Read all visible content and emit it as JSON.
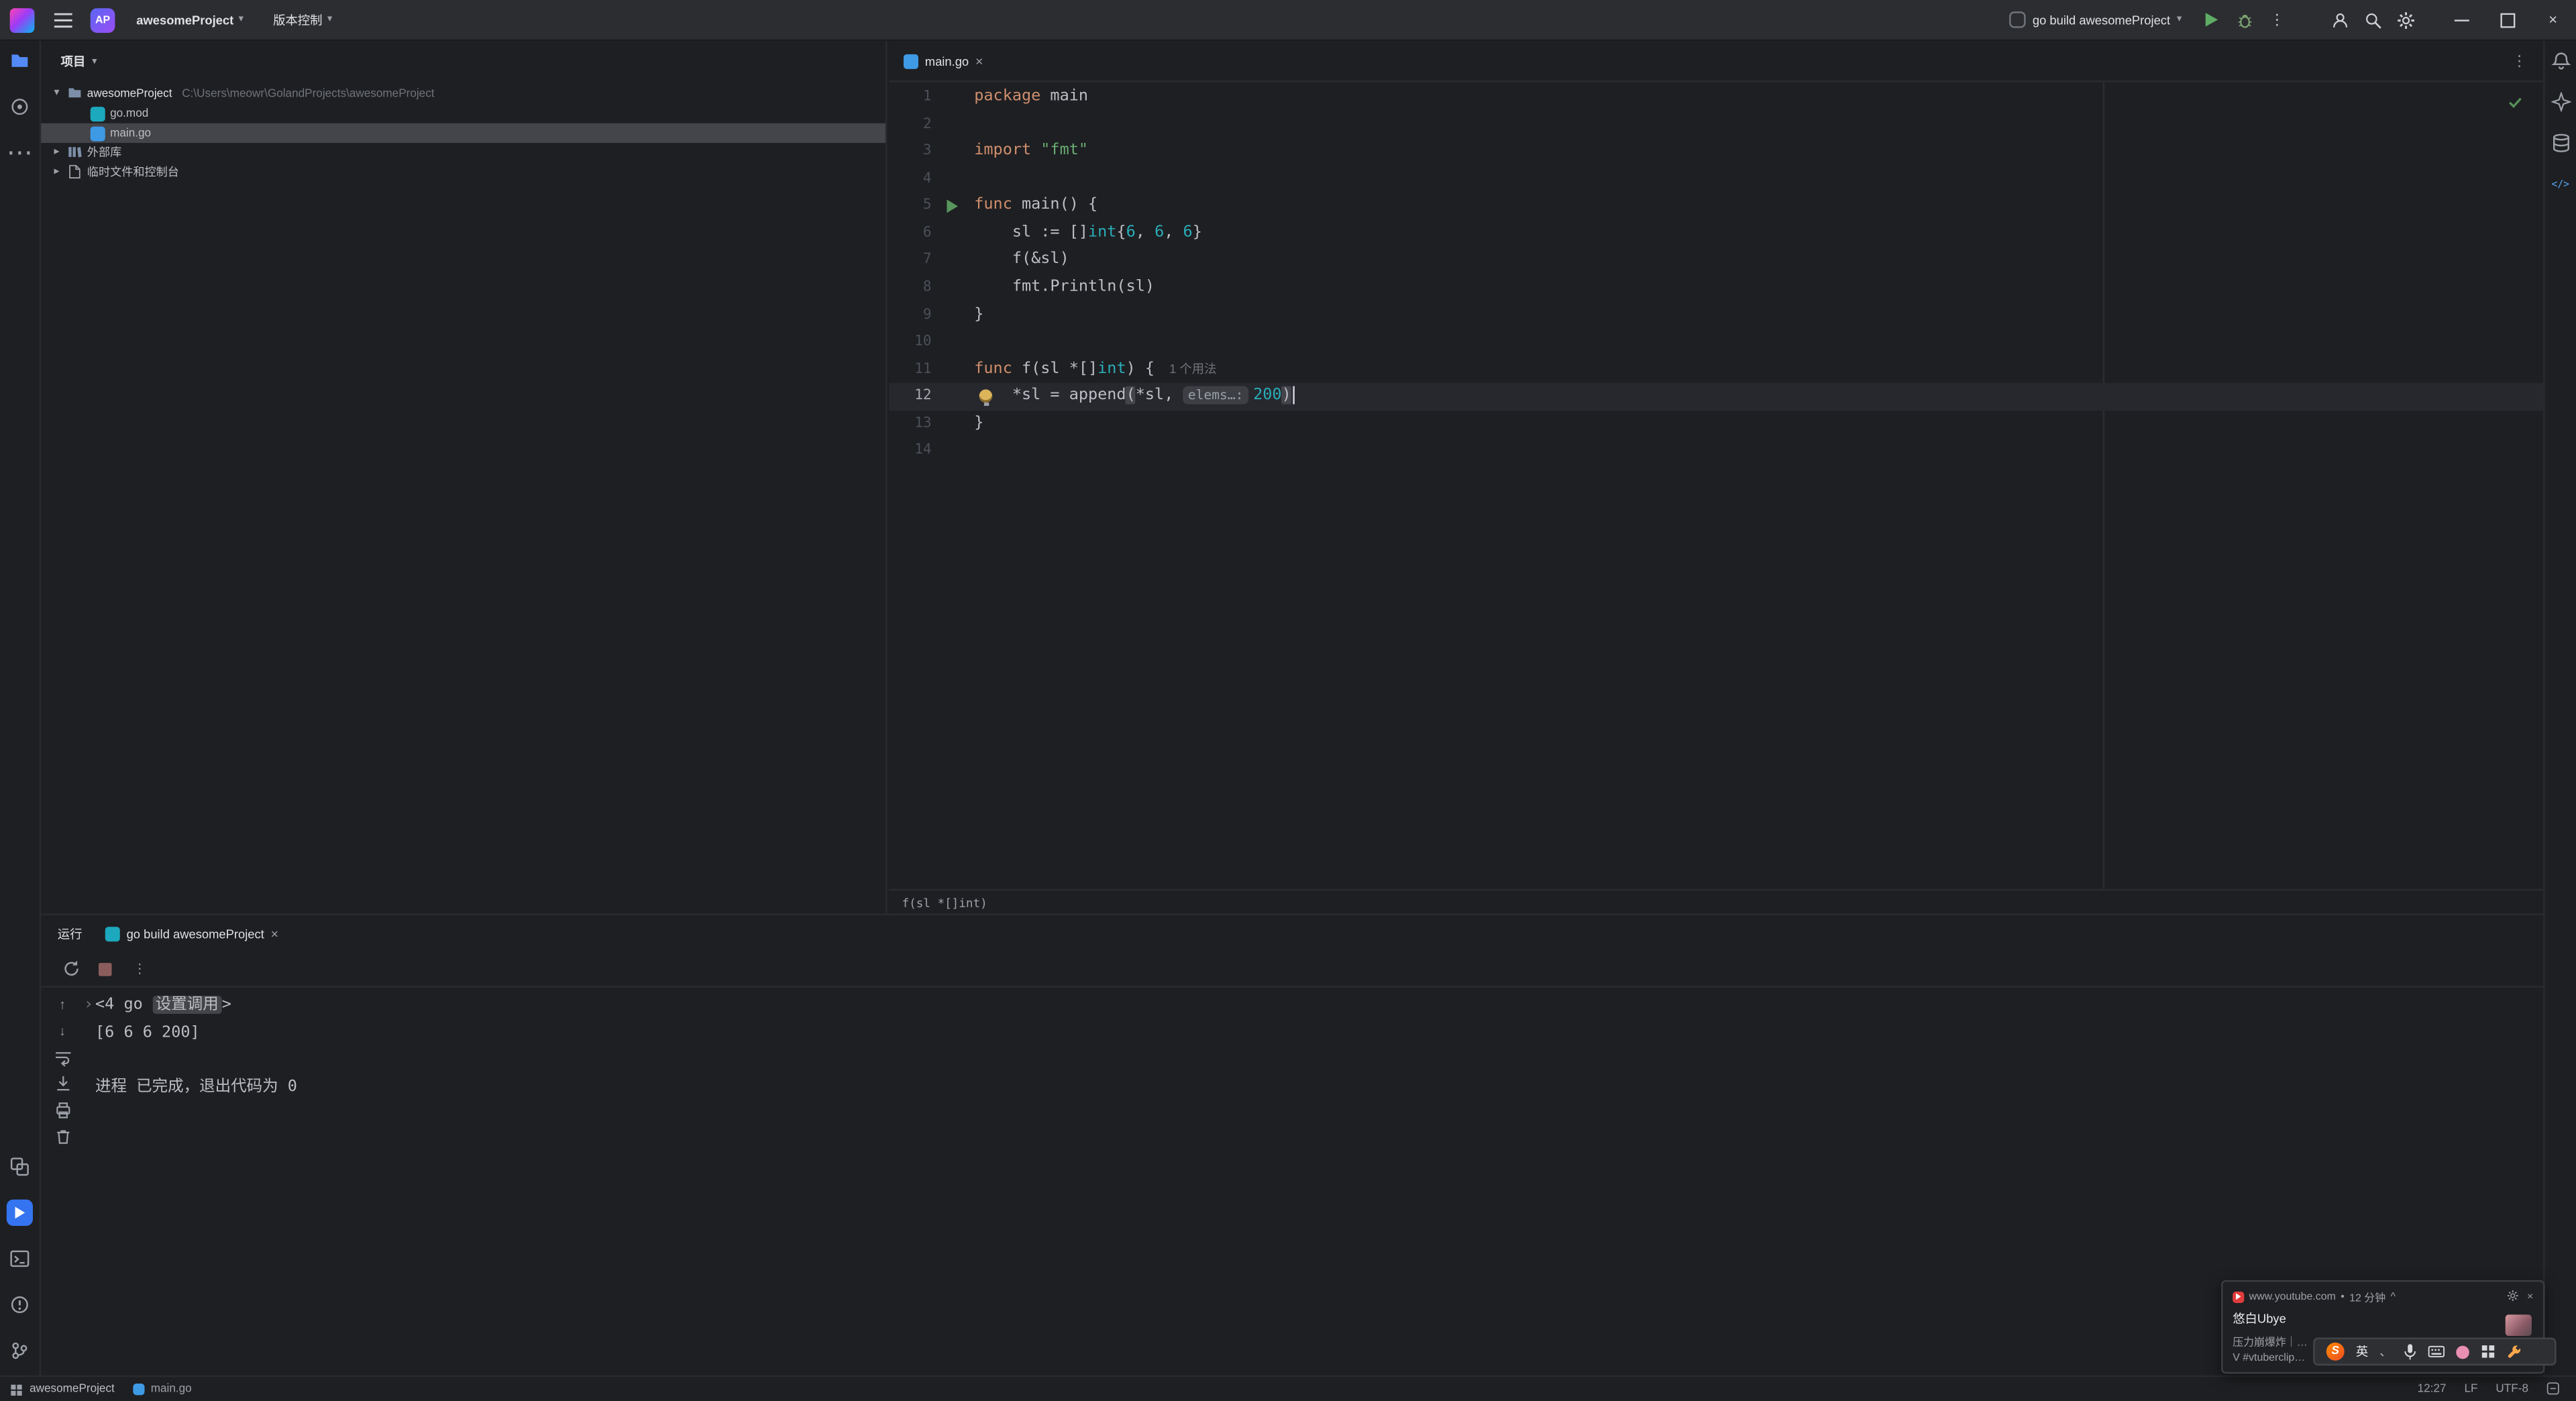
{
  "titlebar": {
    "project_badge": "AP",
    "project_name": "awesomeProject",
    "vcs_label": "版本控制",
    "run_config": "go build awesomeProject"
  },
  "icons": {
    "chevron_down": "▾",
    "chevron_right": "▸",
    "more_vertical": "⋮",
    "more_horizontal": "⋯",
    "close": "×",
    "arrow_up": "↑",
    "arrow_down": "↓",
    "fold_arrow": "›",
    "toast_chevron": "^",
    "bullet": "•",
    "code_tool": "</>"
  },
  "project_panel": {
    "title": "项目",
    "root_name": "awesomeProject",
    "root_path": "C:\\Users\\meowr\\GolandProjects\\awesomeProject",
    "files": [
      {
        "label": "go.mod"
      },
      {
        "label": "main.go"
      }
    ],
    "groups": [
      {
        "label": "外部库"
      },
      {
        "label": "临时文件和控制台"
      }
    ]
  },
  "editor": {
    "tab": "main.go",
    "breadcrumb": "f(sl *[]int)",
    "lines": [
      {
        "n": 1,
        "seg": [
          {
            "t": "package",
            "c": "kw"
          },
          {
            "t": " main",
            "c": "d"
          }
        ]
      },
      {
        "n": 2,
        "seg": []
      },
      {
        "n": 3,
        "seg": [
          {
            "t": "import",
            "c": "kw"
          },
          {
            "t": " ",
            "c": "d"
          },
          {
            "t": "\"fmt\"",
            "c": "str"
          }
        ]
      },
      {
        "n": 4,
        "seg": []
      },
      {
        "n": 5,
        "run": true,
        "seg": [
          {
            "t": "func",
            "c": "kw"
          },
          {
            "t": " main() {",
            "c": "d"
          }
        ]
      },
      {
        "n": 6,
        "seg": [
          {
            "t": "    sl := []",
            "c": "d"
          },
          {
            "t": "int",
            "c": "ty"
          },
          {
            "t": "{",
            "c": "d"
          },
          {
            "t": "6",
            "c": "num"
          },
          {
            "t": ", ",
            "c": "d"
          },
          {
            "t": "6",
            "c": "num"
          },
          {
            "t": ", ",
            "c": "d"
          },
          {
            "t": "6",
            "c": "num"
          },
          {
            "t": "}",
            "c": "d"
          }
        ]
      },
      {
        "n": 7,
        "seg": [
          {
            "t": "    f(&sl)",
            "c": "d"
          }
        ]
      },
      {
        "n": 8,
        "seg": [
          {
            "t": "    fmt.Println(sl)",
            "c": "d"
          }
        ]
      },
      {
        "n": 9,
        "seg": [
          {
            "t": "}",
            "c": "d"
          }
        ]
      },
      {
        "n": 10,
        "seg": []
      },
      {
        "n": 11,
        "hint": "1 个用法",
        "seg": [
          {
            "t": "func",
            "c": "kw"
          },
          {
            "t": " f(sl *[]",
            "c": "d"
          },
          {
            "t": "int",
            "c": "ty"
          },
          {
            "t": ") {",
            "c": "d"
          }
        ]
      },
      {
        "n": 12,
        "cur": true,
        "bulb": true,
        "caret": true,
        "seg": [
          {
            "t": "    *sl = append",
            "c": "d"
          },
          {
            "t": "(",
            "c": "br"
          },
          {
            "t": "*sl, ",
            "c": "d"
          },
          {
            "t": "elems…:",
            "c": "inlay"
          },
          {
            "t": "200",
            "c": "num"
          },
          {
            "t": ")",
            "c": "br"
          }
        ]
      },
      {
        "n": 13,
        "seg": [
          {
            "t": "}",
            "c": "d"
          }
        ]
      },
      {
        "n": 14,
        "seg": []
      }
    ]
  },
  "run_panel": {
    "title": "运行",
    "tab": "go build awesomeProject",
    "console": {
      "lines": [
        {
          "fold": true,
          "seg": [
            {
              "t": "<4 go ",
              "c": "d"
            },
            {
              "t": "设置调用",
              "c": "chip"
            },
            {
              "t": ">",
              "c": "d"
            }
          ]
        },
        {
          "seg": [
            {
              "t": "[6 6 6 200]",
              "c": "d"
            }
          ]
        },
        {
          "seg": []
        },
        {
          "seg": [
            {
              "t": "进程 已完成，退出代码为 0",
              "c": "d"
            }
          ]
        }
      ]
    }
  },
  "statusbar": {
    "project": "awesomeProject",
    "file": "main.go",
    "position": "12:27",
    "line_separator": "LF",
    "encoding": "UTF-8"
  },
  "toast": {
    "source": "www.youtube.com",
    "time": "12 分钟",
    "title": "悠白Ubye",
    "line1": "压力崩爆炸｜…",
    "line2": "V #vtuberclip…"
  },
  "ime": {
    "sogou": "S",
    "mode": "英",
    "dot": "、"
  },
  "colors": {
    "accent": "#3574f0",
    "run_green": "#57965c",
    "keyword_orange": "#cf8e6d",
    "string_green": "#6aab73",
    "number_teal": "#2aacb8",
    "sogou_orange": "#f96d00"
  }
}
